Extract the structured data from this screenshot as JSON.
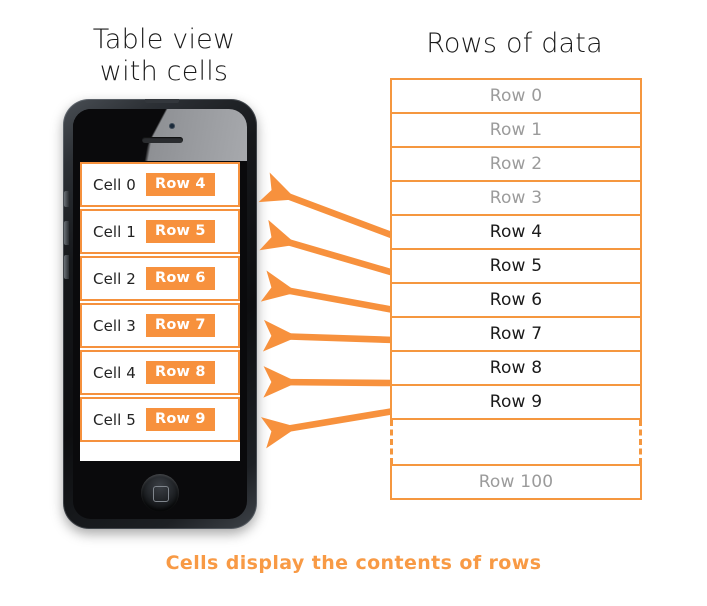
{
  "headings": {
    "left": "Table view\nwith cells",
    "left_line1": "Table view",
    "left_line2": "with cells",
    "right": "Rows of data"
  },
  "colors": {
    "accent_orange": "#F7913D",
    "border_orange": "#F5973F",
    "caption_orange": "#F89A45",
    "dim_text": "#9b9b9b",
    "lit_text": "#1a1a1a",
    "screen_bg": "#ffffff"
  },
  "phone": {
    "device_name": "smartphone-mockup",
    "icons": {
      "camera": "camera-dot-icon",
      "earpiece": "earpiece-speaker-icon",
      "home": "home-button-icon"
    },
    "buttons": {
      "silent_switch": "silent-switch",
      "volume_up": "volume-up-button",
      "volume_down": "volume-down-button"
    },
    "screen": {
      "cells": [
        {
          "label": "Cell 0",
          "badge": "Row 4"
        },
        {
          "label": "Cell 1",
          "badge": "Row 5"
        },
        {
          "label": "Cell 2",
          "badge": "Row 6"
        },
        {
          "label": "Cell 3",
          "badge": "Row 7"
        },
        {
          "label": "Cell 4",
          "badge": "Row 8"
        },
        {
          "label": "Cell 5",
          "badge": "Row 9"
        }
      ]
    }
  },
  "rows_table": {
    "rows": [
      {
        "label": "Row 0",
        "state": "dim"
      },
      {
        "label": "Row 1",
        "state": "dim"
      },
      {
        "label": "Row 2",
        "state": "dim"
      },
      {
        "label": "Row 3",
        "state": "dim"
      },
      {
        "label": "Row 4",
        "state": "lit"
      },
      {
        "label": "Row 5",
        "state": "lit"
      },
      {
        "label": "Row 6",
        "state": "lit"
      },
      {
        "label": "Row 7",
        "state": "lit"
      },
      {
        "label": "Row 8",
        "state": "lit"
      },
      {
        "label": "Row 9",
        "state": "lit"
      }
    ],
    "gap_indicator": "vertical-dashed-ellipsis",
    "last_row": {
      "label": "Row 100",
      "state": "dim"
    }
  },
  "arrows": {
    "count": 6,
    "direction": "right-to-left",
    "description": "arrows from data rows to table view cells",
    "items": [
      {
        "name": "arrow-row4-to-cell0"
      },
      {
        "name": "arrow-row5-to-cell1"
      },
      {
        "name": "arrow-row6-to-cell2"
      },
      {
        "name": "arrow-row7-to-cell3"
      },
      {
        "name": "arrow-row8-to-cell4"
      },
      {
        "name": "arrow-row9-to-cell5"
      }
    ]
  },
  "caption": "Cells display the contents of rows"
}
